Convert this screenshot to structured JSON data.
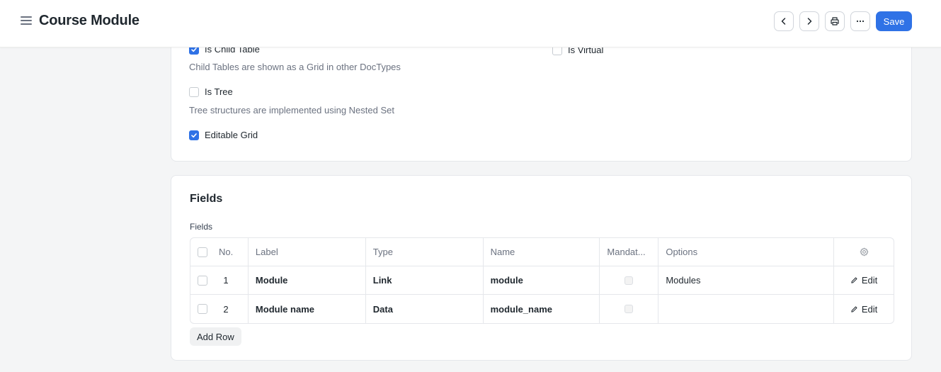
{
  "header": {
    "title": "Course Module",
    "save_label": "Save"
  },
  "settings": {
    "is_child_table": {
      "label": "Is Child Table",
      "checked": true,
      "description": "Child Tables are shown as a Grid in other DocTypes"
    },
    "is_virtual": {
      "label": "Is Virtual",
      "checked": false
    },
    "is_tree": {
      "label": "Is Tree",
      "checked": false,
      "description": "Tree structures are implemented using Nested Set"
    },
    "editable_grid": {
      "label": "Editable Grid",
      "checked": true
    }
  },
  "fields_section": {
    "title": "Fields",
    "field_label": "Fields",
    "columns": [
      "No.",
      "Label",
      "Type",
      "Name",
      "Mandat...",
      "Options"
    ],
    "rows": [
      {
        "no": "1",
        "label": "Module",
        "type": "Link",
        "name": "module",
        "mandatory": false,
        "options": "Modules",
        "edit": "Edit"
      },
      {
        "no": "2",
        "label": "Module name",
        "type": "Data",
        "name": "module_name",
        "mandatory": false,
        "options": "",
        "edit": "Edit"
      }
    ],
    "add_row_label": "Add Row"
  },
  "colors": {
    "accent": "#2f72e6",
    "background": "#f4f5f6"
  }
}
